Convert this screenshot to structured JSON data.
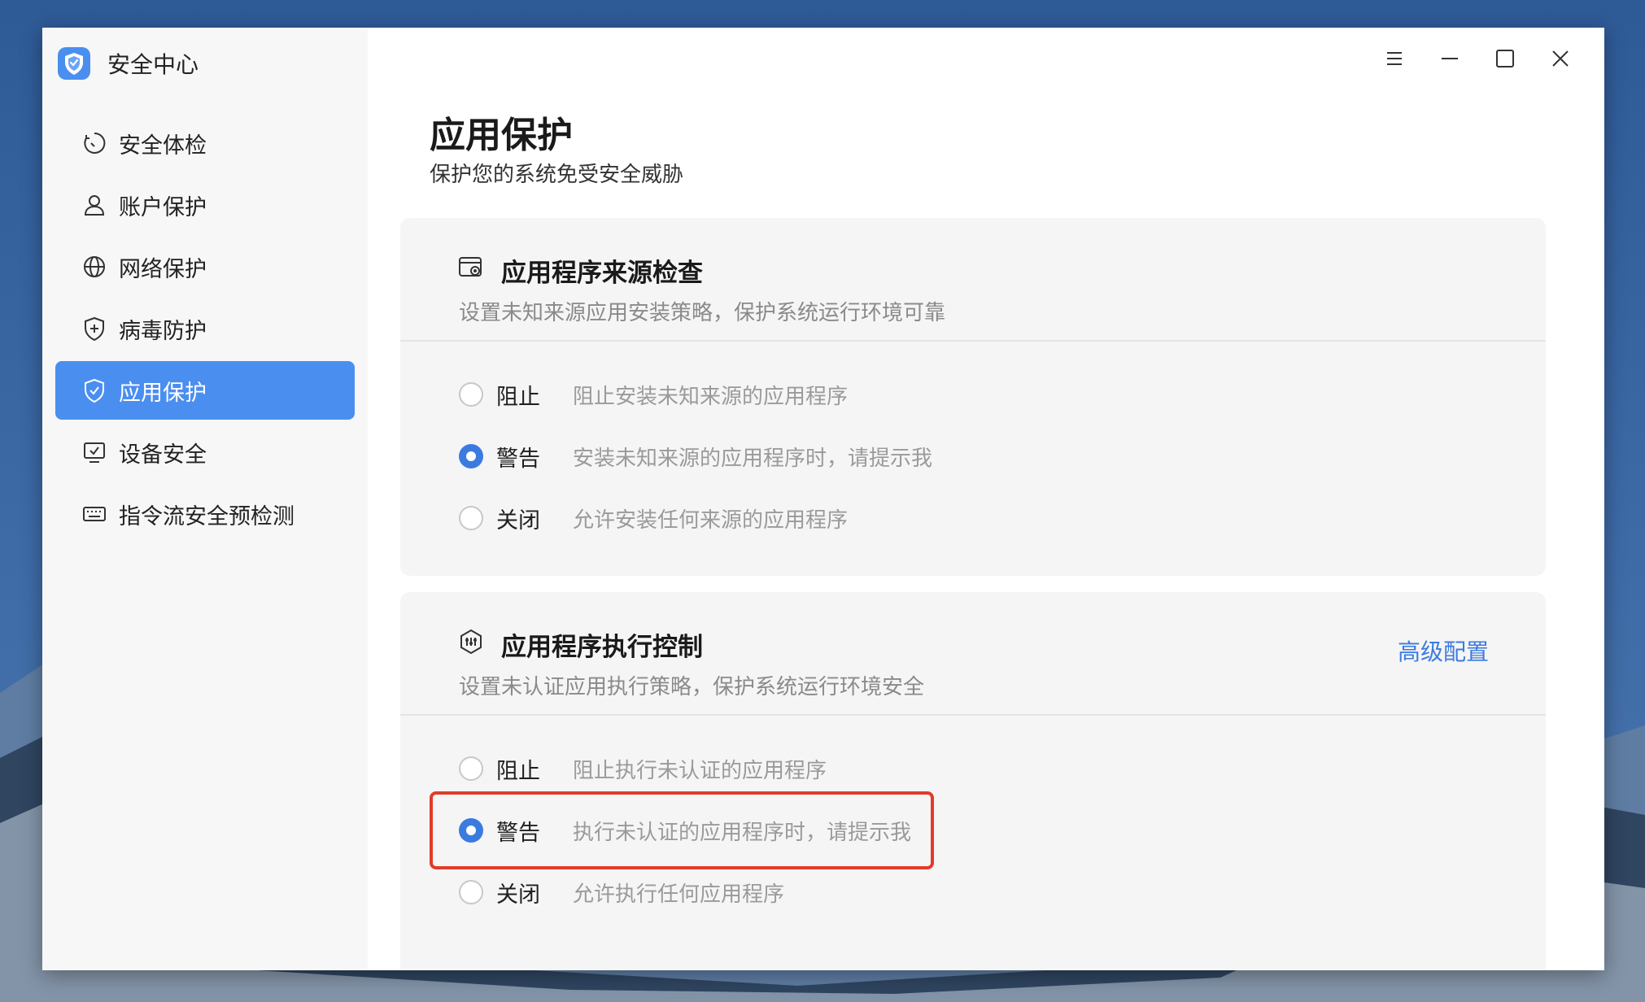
{
  "app": {
    "title": "安全中心"
  },
  "sidebar": {
    "items": [
      {
        "label": "安全体检",
        "icon": "scan-circle-icon"
      },
      {
        "label": "账户保护",
        "icon": "user-icon"
      },
      {
        "label": "网络保护",
        "icon": "globe-icon"
      },
      {
        "label": "病毒防护",
        "icon": "shield-plus-icon"
      },
      {
        "label": "应用保护",
        "icon": "shield-check-icon",
        "active": true
      },
      {
        "label": "设备安全",
        "icon": "monitor-check-icon"
      },
      {
        "label": "指令流安全预检测",
        "icon": "keyboard-icon"
      }
    ]
  },
  "page": {
    "title": "应用保护",
    "subtitle": "保护您的系统免受安全威胁"
  },
  "source_check": {
    "title": "应用程序来源检查",
    "desc": "设置未知来源应用安装策略，保护系统运行环境可靠",
    "options": [
      {
        "label": "阻止",
        "desc": "阻止安装未知来源的应用程序",
        "selected": false
      },
      {
        "label": "警告",
        "desc": "安装未知来源的应用程序时，请提示我",
        "selected": true
      },
      {
        "label": "关闭",
        "desc": "允许安装任何来源的应用程序",
        "selected": false
      }
    ]
  },
  "exec_control": {
    "title": "应用程序执行控制",
    "desc": "设置未认证应用执行策略，保护系统运行环境安全",
    "advanced_label": "高级配置",
    "options": [
      {
        "label": "阻止",
        "desc": "阻止执行未认证的应用程序",
        "selected": false
      },
      {
        "label": "警告",
        "desc": "执行未认证的应用程序时，请提示我",
        "selected": true
      },
      {
        "label": "关闭",
        "desc": "允许执行任何应用程序",
        "selected": false
      }
    ]
  },
  "colors": {
    "accent": "#4a8ef0",
    "link": "#3b7be0",
    "highlight": "#e23b2a"
  }
}
